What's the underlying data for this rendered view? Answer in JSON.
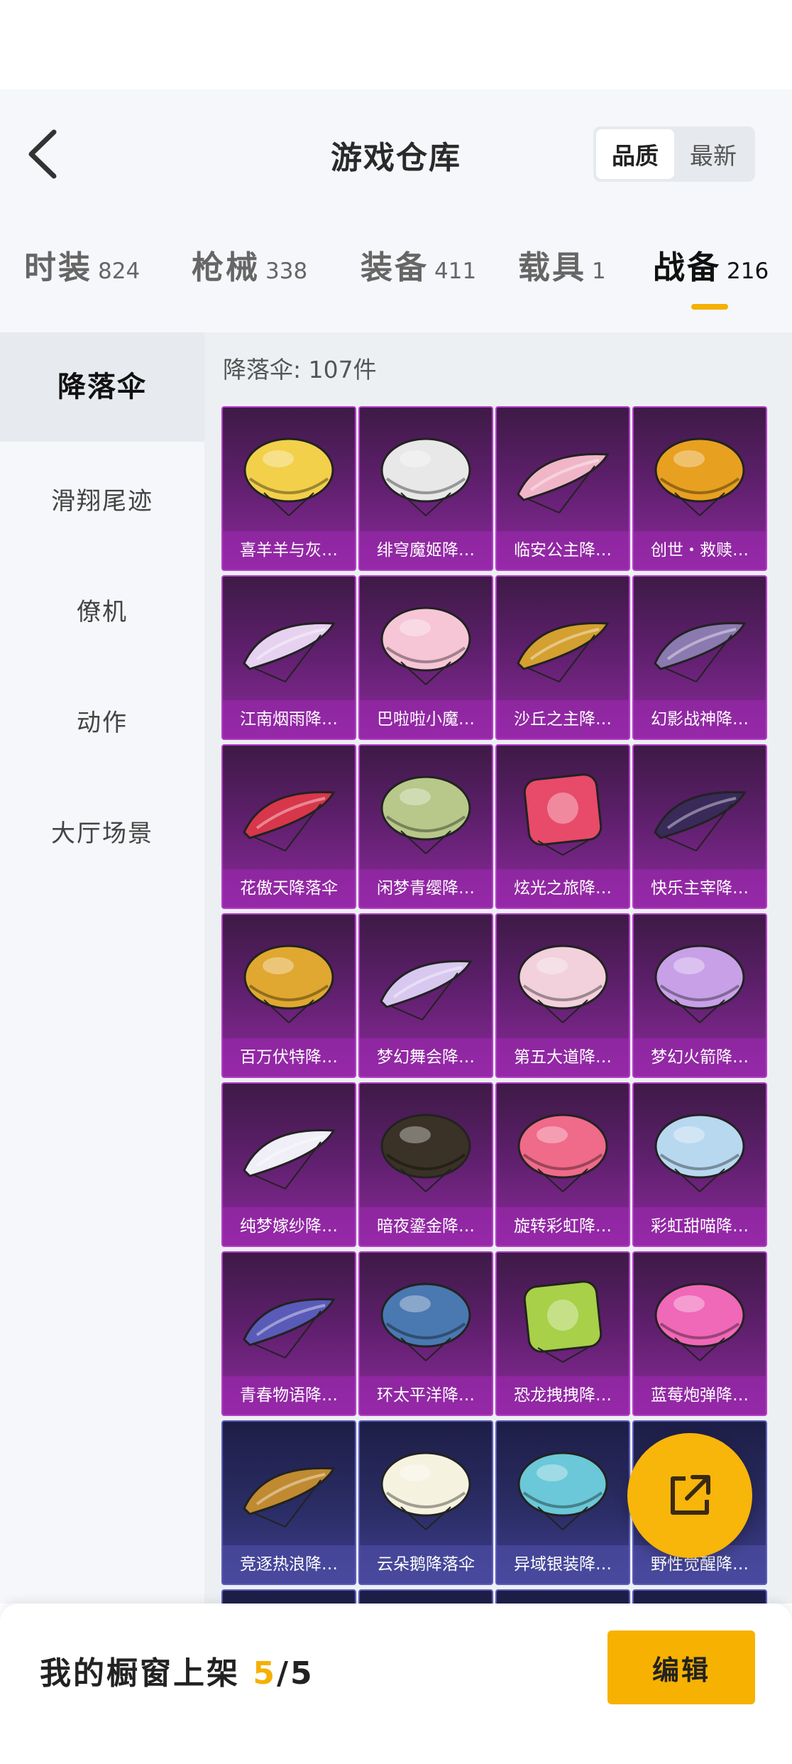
{
  "header": {
    "title": "游戏仓库",
    "sort_options": [
      "品质",
      "最新"
    ],
    "sort_active": 0
  },
  "tabs": [
    {
      "label": "时装",
      "count": "824"
    },
    {
      "label": "枪械",
      "count": "338"
    },
    {
      "label": "装备",
      "count": "411"
    },
    {
      "label": "载具",
      "count": "1"
    },
    {
      "label": "战备",
      "count": "216",
      "active": true
    }
  ],
  "sidebar": {
    "items": [
      "降落伞",
      "滑翔尾迹",
      "僚机",
      "动作",
      "大厅场景"
    ],
    "active": 0
  },
  "main": {
    "count_label": "降落伞: 107件"
  },
  "items": [
    {
      "name": "喜羊羊与灰…",
      "color": "#f2d04a",
      "tier": "purple",
      "shape": "dome"
    },
    {
      "name": "绯穹魔姬降…",
      "color": "#e8e8e8",
      "tier": "purple",
      "shape": "dome"
    },
    {
      "name": "临安公主降…",
      "color": "#f0b6c8",
      "tier": "purple",
      "shape": "wing"
    },
    {
      "name": "创世・救赎…",
      "color": "#e8a020",
      "tier": "purple",
      "shape": "dome"
    },
    {
      "name": "江南烟雨降…",
      "color": "#e6d2f0",
      "tier": "purple",
      "shape": "wing"
    },
    {
      "name": "巴啦啦小魔…",
      "color": "#f6c6d6",
      "tier": "purple",
      "shape": "dome"
    },
    {
      "name": "沙丘之主降…",
      "color": "#d4a030",
      "tier": "purple",
      "shape": "wing"
    },
    {
      "name": "幻影战神降…",
      "color": "#8a7ab0",
      "tier": "purple",
      "shape": "wing"
    },
    {
      "name": "花傲天降落伞",
      "color": "#d8364a",
      "tier": "purple",
      "shape": "wing"
    },
    {
      "name": "闲梦青缨降…",
      "color": "#b8c88a",
      "tier": "purple",
      "shape": "dome"
    },
    {
      "name": "炫光之旅降…",
      "color": "#e84a6a",
      "tier": "purple",
      "shape": "square"
    },
    {
      "name": "快乐主宰降…",
      "color": "#3a2a5a",
      "tier": "purple",
      "shape": "wing"
    },
    {
      "name": "百万伏特降…",
      "color": "#e0a830",
      "tier": "purple",
      "shape": "dome"
    },
    {
      "name": "梦幻舞会降…",
      "color": "#d8c8f0",
      "tier": "purple",
      "shape": "wing"
    },
    {
      "name": "第五大道降…",
      "color": "#f2d0dc",
      "tier": "purple",
      "shape": "dome"
    },
    {
      "name": "梦幻火箭降…",
      "color": "#c8a0e8",
      "tier": "purple",
      "shape": "dome"
    },
    {
      "name": "纯梦嫁纱降…",
      "color": "#f0eef6",
      "tier": "purple",
      "shape": "wing"
    },
    {
      "name": "暗夜鎏金降…",
      "color": "#3a3226",
      "tier": "purple",
      "shape": "dome"
    },
    {
      "name": "旋转彩虹降…",
      "color": "#f06a8a",
      "tier": "purple",
      "shape": "dome"
    },
    {
      "name": "彩虹甜喵降…",
      "color": "#b8d8f0",
      "tier": "purple",
      "shape": "dome"
    },
    {
      "name": "青春物语降…",
      "color": "#5a5ab8",
      "tier": "purple",
      "shape": "wing"
    },
    {
      "name": "环太平洋降…",
      "color": "#4a78b0",
      "tier": "purple",
      "shape": "dome"
    },
    {
      "name": "恐龙拽拽降…",
      "color": "#a8d048",
      "tier": "purple",
      "shape": "square"
    },
    {
      "name": "蓝莓炮弹降…",
      "color": "#f068b8",
      "tier": "purple",
      "shape": "dome"
    },
    {
      "name": "竞逐热浪降…",
      "color": "#c08a30",
      "tier": "blue",
      "shape": "wing"
    },
    {
      "name": "云朵鹅降落伞",
      "color": "#f6f2e0",
      "tier": "blue",
      "shape": "dome"
    },
    {
      "name": "异域银装降…",
      "color": "#6ac8d8",
      "tier": "blue",
      "shape": "dome"
    },
    {
      "name": "野性觉醒降…",
      "color": "#888888",
      "tier": "blue",
      "shape": "dome"
    }
  ],
  "bottom": {
    "showcase_label": "我的橱窗上架",
    "showcase_current": "5",
    "showcase_total": "/5",
    "edit_label": "编辑"
  },
  "colors": {
    "accent": "#f5b000",
    "purple_tier": "#8a2a9a",
    "blue_tier": "#3f3f8e"
  },
  "icons": {
    "back": "chevron-left-icon",
    "share": "external-link-icon"
  }
}
